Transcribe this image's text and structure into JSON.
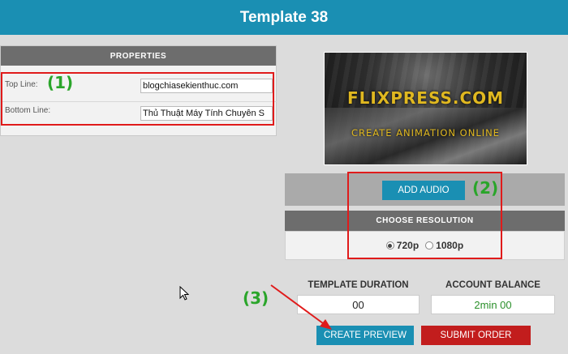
{
  "header": {
    "title": "Template 38"
  },
  "properties": {
    "heading": "PROPERTIES",
    "top_line": {
      "label": "Top Line:",
      "value": "blogchiasekienthuc.com"
    },
    "bottom_line": {
      "label": "Bottom Line:",
      "value": "Thủ Thuật Máy Tính Chuyên S"
    }
  },
  "preview": {
    "logo_text": "FLIXPRESS.COM",
    "tagline": "CREATE ANIMATION ONLINE"
  },
  "audio": {
    "button_label": "ADD AUDIO"
  },
  "resolution": {
    "heading": "CHOOSE RESOLUTION",
    "options": [
      {
        "label": "720p",
        "selected": true
      },
      {
        "label": "1080p",
        "selected": false
      }
    ]
  },
  "template_duration": {
    "label": "TEMPLATE DURATION",
    "value": "00"
  },
  "account_balance": {
    "label": "ACCOUNT BALANCE",
    "value": "2min 00"
  },
  "actions": {
    "create_preview": "CREATE PREVIEW",
    "submit_order": "SUBMIT ORDER"
  },
  "annotations": {
    "a1": "(1)",
    "a2": "(2)",
    "a3": "(3)"
  },
  "colors": {
    "header": "#1a8fb3",
    "primary_button": "#1a8fb3",
    "submit_button": "#c21d1d",
    "highlight": "#e01b1b",
    "annotation": "#2aa52a",
    "balance": "#2a8f2a"
  }
}
